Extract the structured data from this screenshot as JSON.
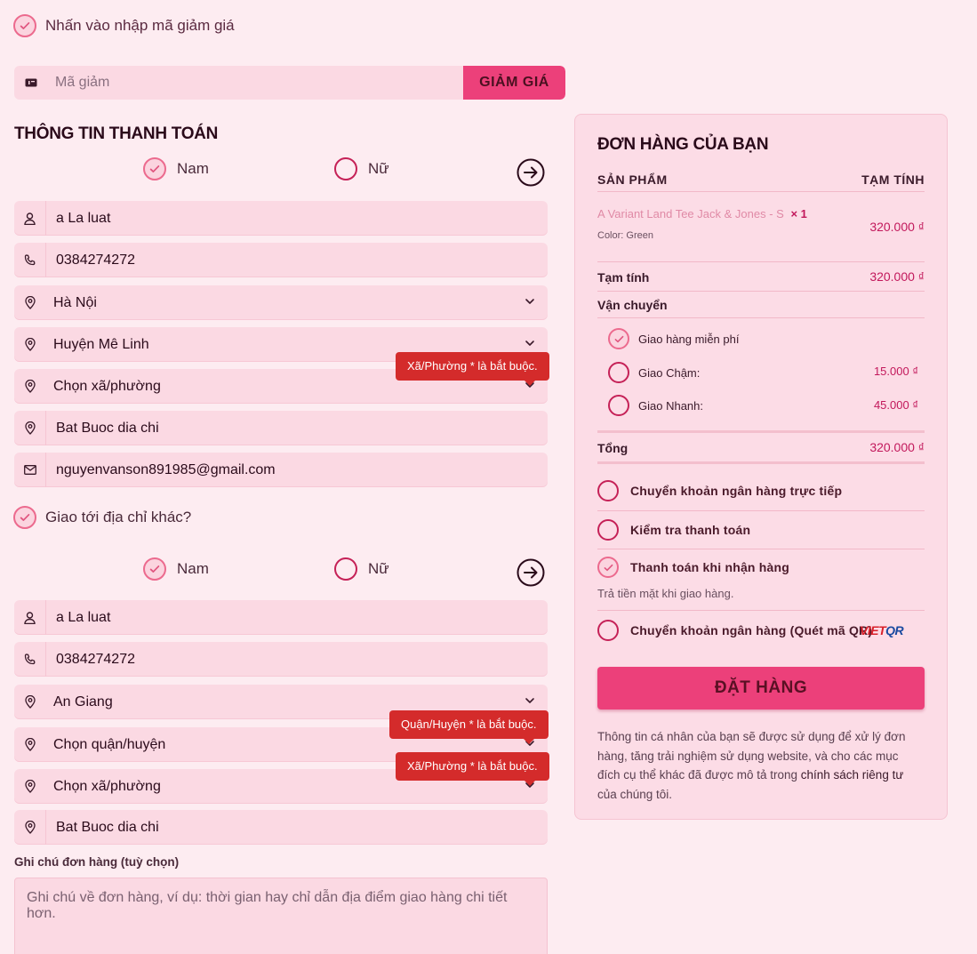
{
  "coupon": {
    "toggle_label": "Nhấn vào nhập mã giảm giá",
    "placeholder": "Mã giảm",
    "button_label": "GIẢM GIÁ"
  },
  "billing": {
    "title": "THÔNG TIN THANH TOÁN",
    "gender_male": "Nam",
    "gender_female": "Nữ",
    "name": "a La luat",
    "phone": "0384274272",
    "province": "Hà Nội",
    "district": "Huyện Mê Linh",
    "ward": "Chọn xã/phường",
    "ward_error": "Xã/Phường * là bắt buộc.",
    "address": "Bat Buoc dia chi",
    "email": "nguyenvanson891985@gmail.com"
  },
  "shipping": {
    "toggle_label": "Giao tới địa chỉ khác?",
    "gender_male": "Nam",
    "gender_female": "Nữ",
    "name": "a La luat",
    "phone": "0384274272",
    "province": "An Giang",
    "district": "Chọn quận/huyện",
    "district_error": "Quận/Huyện * là bắt buộc.",
    "ward": "Chọn xã/phường",
    "ward_error": "Xã/Phường * là bắt buộc.",
    "address": "Bat Buoc dia chi"
  },
  "notes": {
    "label": "Ghi chú đơn hàng (tuỳ chọn)",
    "placeholder": "Ghi chú về đơn hàng, ví dụ: thời gian hay chỉ dẫn địa điểm giao hàng chi tiết hơn."
  },
  "order": {
    "title": "ĐƠN HÀNG CỦA BẠN",
    "col_product": "SẢN PHẨM",
    "col_subtotal": "TẠM TÍNH",
    "item_name": "A Variant Land Tee Jack & Jones - S",
    "item_qty": "× 1",
    "item_meta_key": "Color:",
    "item_meta_val": "Green",
    "item_price": "320.000 ₫",
    "subtotal_label": "Tạm tính",
    "subtotal_value": "320.000 ₫",
    "shipping_label": "Vận chuyển",
    "ship_free": "Giao hàng miễn phí",
    "ship_slow": "Giao Chậm:",
    "ship_slow_price": "15.000 ₫",
    "ship_fast": "Giao Nhanh:",
    "ship_fast_price": "45.000 ₫",
    "total_label": "Tổng",
    "total_value": "320.000 ₫",
    "pay_bank": "Chuyển khoản ngân hàng trực tiếp",
    "pay_check": "Kiểm tra thanh toán",
    "pay_cod": "Thanh toán khi nhận hàng",
    "pay_cod_desc": "Trả tiền mặt khi giao hàng.",
    "pay_qr": "Chuyển khoản ngân hàng (Quét mã QR)",
    "vietqr_logo": "VIETQR",
    "place_order": "ĐẶT HÀNG",
    "privacy_text": "Thông tin cá nhân của bạn sẽ được sử dụng để xử lý đơn hàng, tăng trải nghiệm sử dụng website, và cho các mục đích cụ thể khác đã được mô tả trong ",
    "privacy_link": "chính sách riêng tư",
    "privacy_end": " của chúng tôi."
  },
  "colors": {
    "accent": "#ec407a",
    "background": "#fdecf1",
    "error": "#d42b2b"
  }
}
